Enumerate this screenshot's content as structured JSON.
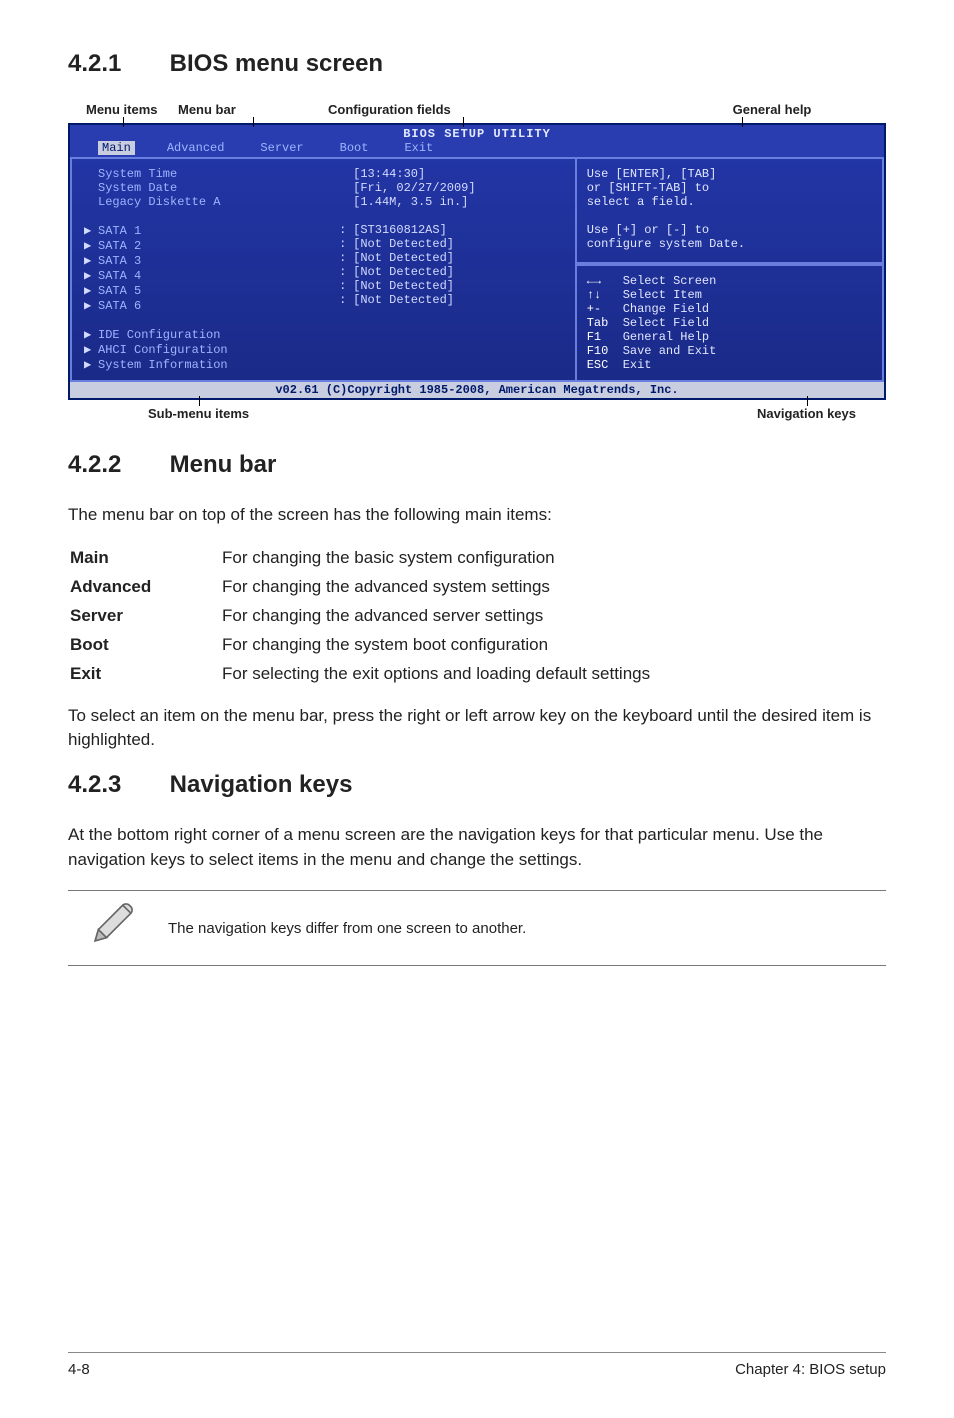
{
  "section_421": {
    "num": "4.2.1",
    "title": "BIOS menu screen"
  },
  "diagram_labels": {
    "menu_items": "Menu items",
    "menu_bar": "Menu bar",
    "config_fields": "Configuration fields",
    "general_help": "General help",
    "sub_menu": "Sub-menu items",
    "nav_keys": "Navigation keys"
  },
  "bios": {
    "title": "BIOS SETUP UTILITY",
    "menubar": [
      "Main",
      "Advanced",
      "Server",
      "Boot",
      "Exit"
    ],
    "left_rows": [
      {
        "arrow": "",
        "label": "System Time",
        "value": "[13:44:30]"
      },
      {
        "arrow": "",
        "label": "System Date",
        "value": "[Fri, 02/27/2009]"
      },
      {
        "arrow": "",
        "label": "Legacy Diskette A",
        "value": "[1.44M, 3.5 in.]"
      },
      {
        "arrow": "",
        "label": "",
        "value": ""
      },
      {
        "arrow": "▶",
        "label": "SATA 1",
        "colon": ":",
        "value": "[ST3160812AS]"
      },
      {
        "arrow": "▶",
        "label": "SATA 2",
        "colon": ":",
        "value": "[Not Detected]"
      },
      {
        "arrow": "▶",
        "label": "SATA 3",
        "colon": ":",
        "value": "[Not Detected]"
      },
      {
        "arrow": "▶",
        "label": "SATA 4",
        "colon": ":",
        "value": "[Not Detected]"
      },
      {
        "arrow": "▶",
        "label": "SATA 5",
        "colon": ":",
        "value": "[Not Detected]"
      },
      {
        "arrow": "▶",
        "label": "SATA 6",
        "colon": ":",
        "value": "[Not Detected]"
      },
      {
        "arrow": "",
        "label": "",
        "value": ""
      },
      {
        "arrow": "▶",
        "label": "IDE Configuration",
        "value": ""
      },
      {
        "arrow": "▶",
        "label": "AHCI Configuration",
        "value": ""
      },
      {
        "arrow": "▶",
        "label": "System Information",
        "value": ""
      }
    ],
    "help_top": [
      "Use [ENTER], [TAB]",
      "or [SHIFT-TAB] to",
      "select a field.",
      "",
      "Use [+] or [-] to",
      "configure system Date."
    ],
    "help_bot": [
      {
        "key": "←→",
        "desc": "Select Screen"
      },
      {
        "key": "↑↓",
        "desc": "Select Item"
      },
      {
        "key": "+-",
        "desc": "Change Field"
      },
      {
        "key": "Tab",
        "desc": "Select Field"
      },
      {
        "key": "F1",
        "desc": "General Help"
      },
      {
        "key": "F10",
        "desc": "Save and Exit"
      },
      {
        "key": "ESC",
        "desc": "Exit"
      }
    ],
    "footer": "v02.61 (C)Copyright 1985-2008, American Megatrends, Inc."
  },
  "section_422": {
    "num": "4.2.2",
    "title": "Menu bar",
    "intro": "The menu bar on top of the screen has the following main items:",
    "rows": [
      {
        "term": "Main",
        "desc": "For changing the basic system configuration"
      },
      {
        "term": "Advanced",
        "desc": "For changing the advanced system settings"
      },
      {
        "term": "Server",
        "desc": "For changing the advanced server settings"
      },
      {
        "term": "Boot",
        "desc": "For changing the system boot configuration"
      },
      {
        "term": "Exit",
        "desc": "For selecting the exit options and loading default settings"
      }
    ],
    "after": "To select an item on the menu bar, press the right or left arrow key on the keyboard until the desired item is highlighted."
  },
  "section_423": {
    "num": "4.2.3",
    "title": "Navigation keys",
    "body": "At the bottom right corner of a menu screen are the navigation keys for that particular menu. Use the navigation keys to select items in the menu and change the settings.",
    "note": "The navigation keys differ from one screen to another."
  },
  "page_footer": {
    "left": "4-8",
    "right": "Chapter 4: BIOS setup"
  }
}
